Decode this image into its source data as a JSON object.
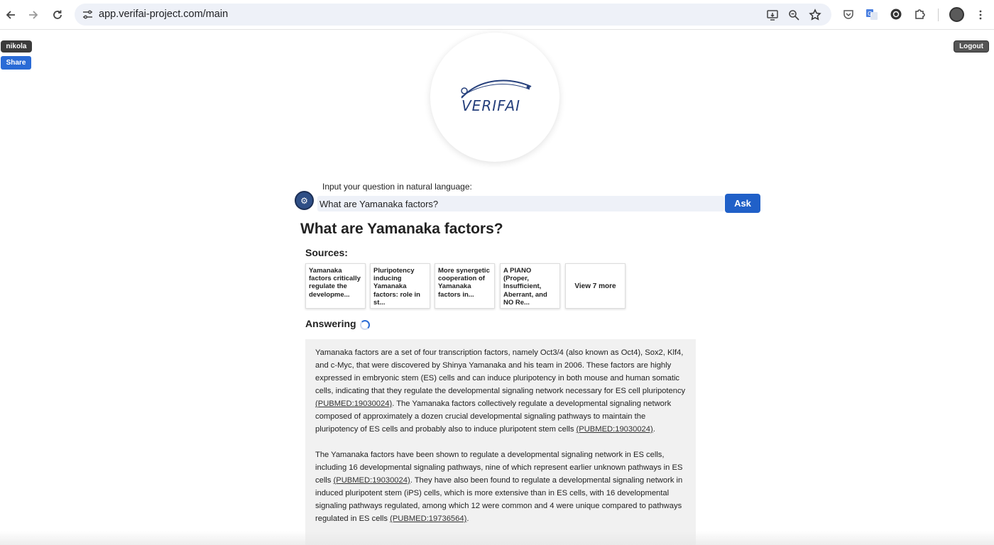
{
  "browser": {
    "url": "app.verifai-project.com/main"
  },
  "header": {
    "username": "nikola",
    "share_label": "Share",
    "logout_label": "Logout",
    "logo_text": "VERIFAI"
  },
  "query": {
    "label": "Input your question in natural language:",
    "value": "What are Yamanaka factors?",
    "ask_label": "Ask"
  },
  "result": {
    "question": "What are Yamanaka factors?",
    "sources_title": "Sources:",
    "sources": [
      "Yamanaka factors critically regulate the developme...",
      "Pluripotency inducing Yamanaka factors: role in st...",
      "More synergetic cooperation of Yamanaka factors in...",
      "A PIANO (Proper, Insufficient, Aberrant, and NO Re..."
    ],
    "view_more_label": "View 7 more",
    "status_label": "Answering",
    "answer": {
      "p1_a": "Yamanaka factors are a set of four transcription factors, namely Oct3/4 (also known as Oct4), Sox2, Klf4, and c-Myc, that were discovered by Shinya Yamanaka and his team in 2006. These factors are highly expressed in embryonic stem (ES) cells and can induce pluripotency in both mouse and human somatic cells, indicating that they regulate the developmental signaling network necessary for ES cell pluripotency ",
      "p1_cite1": "(PUBMED:19030024)",
      "p1_b": ". The Yamanaka factors collectively regulate a developmental signaling network composed of approximately a dozen crucial developmental signaling pathways to maintain the pluripotency of ES cells and probably also to induce pluripotent stem cells ",
      "p1_cite2": "(PUBMED:19030024)",
      "p1_c": ".",
      "p2_a": "The Yamanaka factors have been shown to regulate a developmental signaling network in ES cells, including 16 developmental signaling pathways, nine of which represent earlier unknown pathways in ES cells ",
      "p2_cite1": "(PUBMED:19030024)",
      "p2_b": ". They have also been found to regulate a developmental signaling network in induced pluripotent stem (iPS) cells, which is more extensive than in ES cells, with 16 developmental signaling pathways regulated, among which 12 were common and 4 were unique compared to pathways regulated in ES cells ",
      "p2_cite2": "(PUBMED:19736564)",
      "p2_c": "."
    }
  },
  "colors": {
    "accent": "#2060c8",
    "omnibox": "#eef1f8",
    "answer_bg": "#f1f1f1",
    "logo": "#26407c"
  }
}
